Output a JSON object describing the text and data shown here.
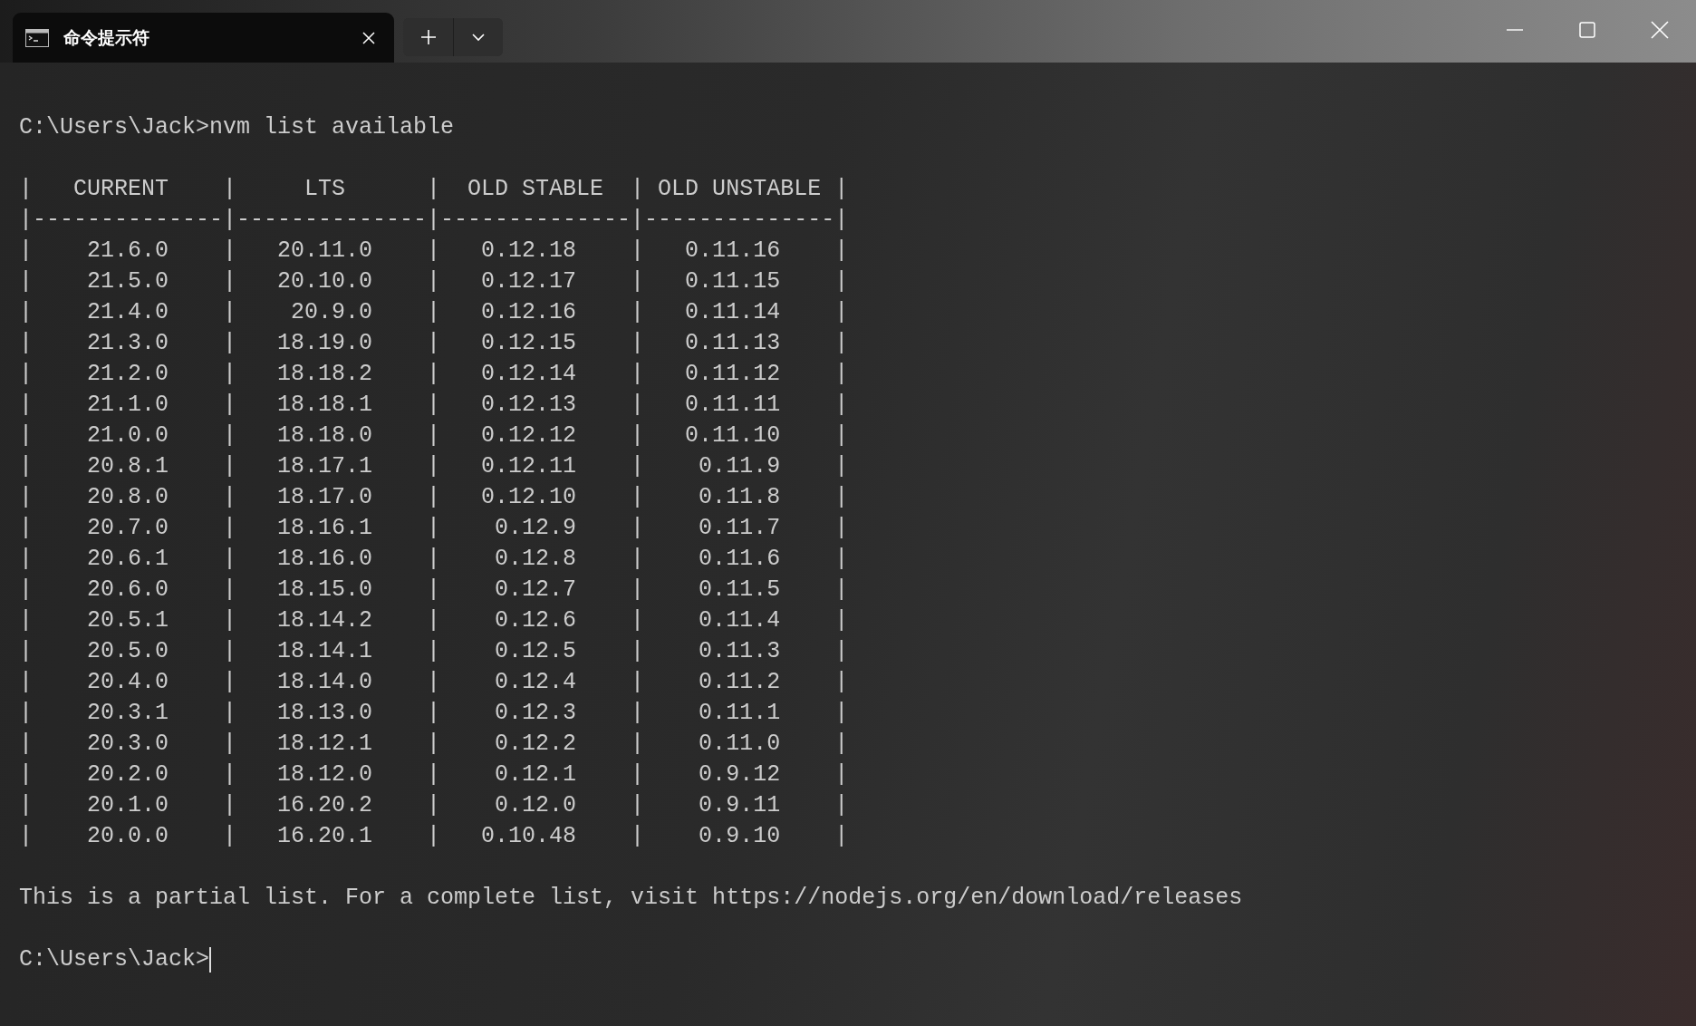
{
  "window": {
    "tab": {
      "title": "命令提示符",
      "selected": true
    }
  },
  "terminal": {
    "blocks": [
      {
        "lines": [
          "C:\\Users\\Jack>nvm list available"
        ]
      },
      {
        "lines": [
          "|   CURRENT    |     LTS      |  OLD STABLE  | OLD UNSTABLE |",
          "|--------------|--------------|--------------|--------------|",
          "|    21.6.0    |   20.11.0    |   0.12.18    |   0.11.16    |",
          "|    21.5.0    |   20.10.0    |   0.12.17    |   0.11.15    |",
          "|    21.4.0    |    20.9.0    |   0.12.16    |   0.11.14    |",
          "|    21.3.0    |   18.19.0    |   0.12.15    |   0.11.13    |",
          "|    21.2.0    |   18.18.2    |   0.12.14    |   0.11.12    |",
          "|    21.1.0    |   18.18.1    |   0.12.13    |   0.11.11    |",
          "|    21.0.0    |   18.18.0    |   0.12.12    |   0.11.10    |",
          "|    20.8.1    |   18.17.1    |   0.12.11    |    0.11.9    |",
          "|    20.8.0    |   18.17.0    |   0.12.10    |    0.11.8    |",
          "|    20.7.0    |   18.16.1    |    0.12.9    |    0.11.7    |",
          "|    20.6.1    |   18.16.0    |    0.12.8    |    0.11.6    |",
          "|    20.6.0    |   18.15.0    |    0.12.7    |    0.11.5    |",
          "|    20.5.1    |   18.14.2    |    0.12.6    |    0.11.4    |",
          "|    20.5.0    |   18.14.1    |    0.12.5    |    0.11.3    |",
          "|    20.4.0    |   18.14.0    |    0.12.4    |    0.11.2    |",
          "|    20.3.1    |   18.13.0    |    0.12.3    |    0.11.1    |",
          "|    20.3.0    |   18.12.1    |    0.12.2    |    0.11.0    |",
          "|    20.2.0    |   18.12.0    |    0.12.1    |    0.9.12    |",
          "|    20.1.0    |   16.20.2    |    0.12.0    |    0.9.11    |",
          "|    20.0.0    |   16.20.1    |   0.10.48    |    0.9.10    |"
        ]
      },
      {
        "lines": [
          "This is a partial list. For a complete list, visit https://nodejs.org/en/download/releases"
        ]
      },
      {
        "lines": [
          "C:\\Users\\Jack>"
        ],
        "cursor": true
      }
    ]
  }
}
